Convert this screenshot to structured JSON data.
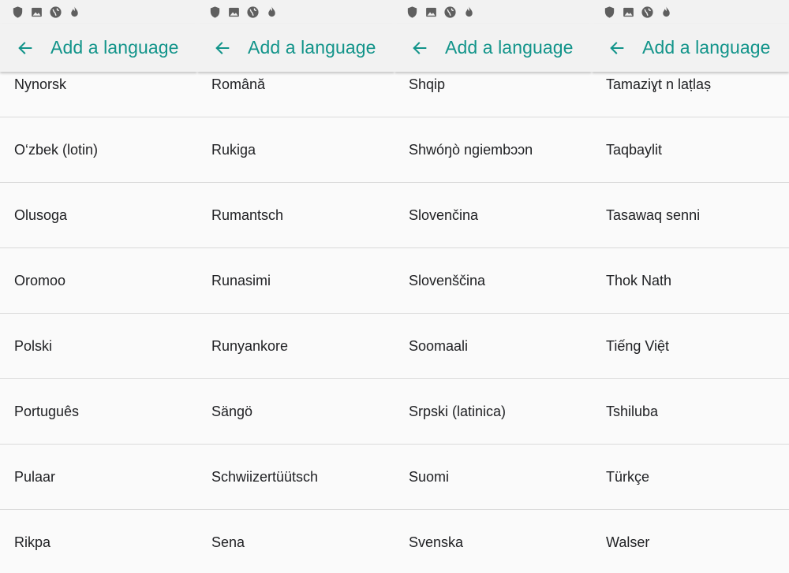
{
  "accent_color": "#12948a",
  "status_icons": [
    "shield-icon",
    "image-icon",
    "globe-icon",
    "flame-icon"
  ],
  "title": "Add a language",
  "panels": [
    {
      "items": [
        "Nynorsk",
        "O‘zbek (lotin)",
        "Olusoga",
        "Oromoo",
        "Polski",
        "Português",
        "Pulaar",
        "Rikpa"
      ]
    },
    {
      "items": [
        "Română",
        "Rukiga",
        "Rumantsch",
        "Runasimi",
        "Runyankore",
        "Sängö",
        "Schwiizertüütsch",
        "Sena"
      ]
    },
    {
      "items": [
        "Shqip",
        "Shwóŋò ngiembɔɔn",
        "Slovenčina",
        "Slovenščina",
        "Soomaali",
        "Srpski (latinica)",
        "Suomi",
        "Svenska"
      ]
    },
    {
      "items": [
        "Tamaziɣt n laṭlaṣ",
        "Taqbaylit",
        "Tasawaq senni",
        "Thok Nath",
        "Tiếng Việt",
        "Tshiluba",
        "Türkçe",
        "Walser"
      ]
    }
  ]
}
